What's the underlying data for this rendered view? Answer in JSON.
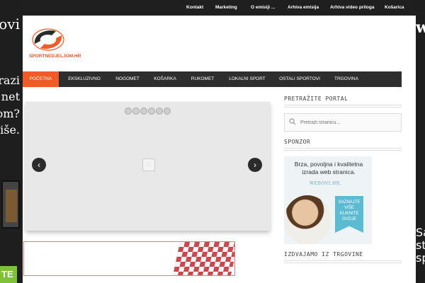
{
  "side_left": {
    "lines": [
      "ovi",
      "razi",
      "net",
      "om?",
      "više."
    ],
    "cta": "TE"
  },
  "side_right": {
    "lines": [
      "w",
      "Sa",
      "st",
      "sp"
    ]
  },
  "topbar": {
    "links": [
      "Kontakt",
      "Marketing",
      "O emisiji ...",
      "Arhiva emisija",
      "Arhiva video priloga",
      "Košarica"
    ]
  },
  "logo": {
    "brand": "SPORTNEDJELJOM.HR"
  },
  "nav": {
    "items": [
      "POČETNA",
      "EKSKLUZIVNO",
      "NOGOMET",
      "KOŠARKA",
      "RUKOMET",
      "LOKALNI SPORT",
      "OSTALI SPORTOVI",
      "TRGOVINA"
    ]
  },
  "slider": {
    "prev": "‹",
    "next": "›",
    "dot_count": 6
  },
  "sidebar": {
    "search_title": "PRETRAŽITE PORTAL",
    "search_placeholder": "Pretraži stranicu...",
    "sponsor_title": "SPONZOR",
    "ad_headline": "Brza, povoljna i kvalitetna izrada web stranica.",
    "ad_site": "WEBOVI.HR.",
    "ad_badge": "SAZNAJTE VIŠE KLIKNITE OVDJE",
    "shop_title": "IZDVAJAMO IZ TRGOVINE"
  },
  "colors": {
    "accent": "#f05a24",
    "nav_bg": "#2e2e2e",
    "topbar_bg": "#1f1f1f"
  }
}
